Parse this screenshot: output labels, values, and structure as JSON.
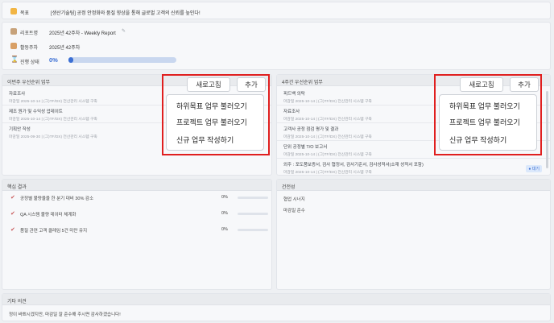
{
  "goal": {
    "label": "목표",
    "text": "[생산기술팀] 공정 안정화와 품질 향상을 통해 글로벌 고객의 신뢰를 높인다!"
  },
  "info": {
    "roadmap_label": "리포트명",
    "roadmap_value": "2025년 42주차 - Weekly Report",
    "week_label": "활동주차",
    "week_value": "2025년 42주차",
    "progress_label": "진행 상태",
    "progress_value": "0%",
    "progress_fraction": 0.02
  },
  "this_week": {
    "title": "이번주 우선순위 업무",
    "items": [
      {
        "title": "자료조사",
        "meta": "마감일 2025-10-14 | (그)TF/DX) 전산관리 시스템 구축"
      },
      {
        "title": "제조 원가 및 수익성 업데이트",
        "meta": "마감일 2025-10-14 | (그)TF/DX) 전산관리 시스템 구축"
      },
      {
        "title": "기획안 작성",
        "meta": "마감일 2025-09-30 | (그)TF/DX) 전산관리 시스템 구축"
      }
    ],
    "refresh": "새로고침",
    "add": "추가",
    "menu": [
      "하위목표 업무 불러오기",
      "프로젝트 업무 불러오기",
      "신규 업무 작성하기"
    ]
  },
  "four_week": {
    "title": "4주간 우선순위 업무",
    "items": [
      {
        "title": "피드백 의탁",
        "meta": "마감일 2025-10-14 | (그)TF/DX) 전산관리 시스템 구축"
      },
      {
        "title": "자료조사",
        "meta": "마감일 2025-10-14 | (그)TF/DX) 전산관리 시스템 구축"
      },
      {
        "title": "고객사 공정 점검 평가 및 결과",
        "meta": "마감일 2025-10-14 | (그)TF/DX) 전산관리 시스템 구축"
      },
      {
        "title": "단위 공정별 T/O 보고서",
        "meta": "마감일 2025-10-14 | (그)TF/DX) 전산관리 시스템 구축"
      },
      {
        "title": "외주 : 포도품보증서, 검사 협정서, 검사기준서, 검사성적서(소재 성적서 포함)",
        "meta": "마감일 2025-10-14 | (그)TF/DX) 전산관리 시스템 구축",
        "badge": "대기"
      }
    ],
    "refresh": "새로고침",
    "add": "추가",
    "menu": [
      "하위목표 업무 불러오기",
      "프로젝트 업무 불러오기",
      "신규 업무 작성하기"
    ]
  },
  "key_results": {
    "title": "핵심 결과",
    "items": [
      {
        "label": "공정별 불량율을 한 분기 대비 30% 감소",
        "value": "0%"
      },
      {
        "label": "QA 시스템 불량 데이터 체계화",
        "value": "0%"
      },
      {
        "label": "품질 관련 고객 클레임 5건 미만 유지",
        "value": "0%"
      }
    ]
  },
  "suggestions": {
    "title": "건전성",
    "items": [
      "협업 시너지",
      "마감일 준수"
    ]
  },
  "other": {
    "title": "기타 의견",
    "text": "정이 바쁘시겠지만, 마감일 잘 준수해 주시면 감사하겠습니다!"
  }
}
